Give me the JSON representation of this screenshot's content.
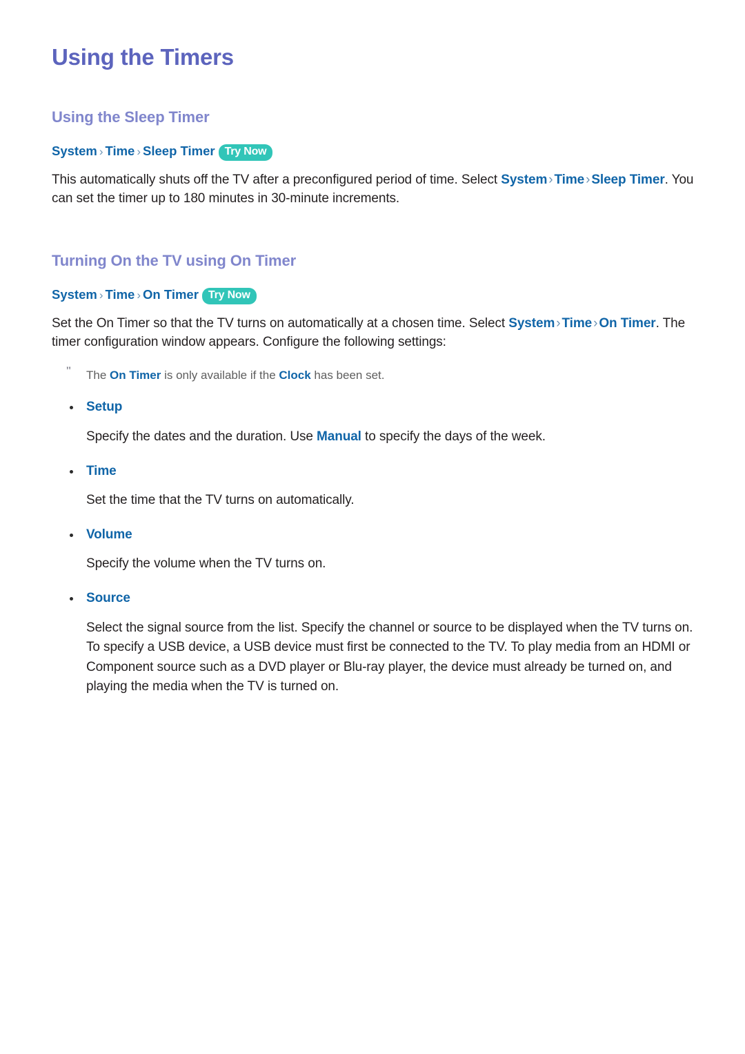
{
  "document": {
    "title": "Using the Timers"
  },
  "sections": [
    {
      "heading": "Using the Sleep Timer",
      "breadcrumb": {
        "crumbs": [
          "System",
          "Time",
          "Sleep Timer"
        ],
        "separator": "›",
        "badge": "Try Now"
      },
      "paragraph": {
        "part1": "This automatically shuts off the TV after a preconfigured period of time. Select ",
        "menu1": "System",
        "sep1": "›",
        "menu2": "Time",
        "sep2": "›",
        "menu3": "Sleep Timer",
        "part2": ". You can set the timer up to 180 minutes in 30-minute increments."
      }
    },
    {
      "heading": "Turning On the TV using On Timer",
      "breadcrumb": {
        "crumbs": [
          "System",
          "Time",
          "On Timer"
        ],
        "separator": "›",
        "badge": "Try Now"
      },
      "paragraph": {
        "part1": "Set the On Timer so that the TV turns on automatically at a chosen time. Select ",
        "menu1": "System",
        "sep1": "›",
        "menu2": "Time",
        "sep2": "›",
        "menu3": "On Timer",
        "part2": ". The timer configuration window appears. Configure the following settings:"
      },
      "note": {
        "icon": "quote-mark",
        "glyph": "\"",
        "part1": "The ",
        "menu1": "On Timer",
        "part2": " is only available if the ",
        "menu2": "Clock",
        "part3": " has been set."
      },
      "bullets": [
        {
          "label": "Setup",
          "desc_part1": "Specify the dates and the duration. Use ",
          "desc_menu": "Manual",
          "desc_part2": " to specify the days of the week."
        },
        {
          "label": "Time",
          "desc_part1": "Set the time that the TV turns on automatically.",
          "desc_menu": "",
          "desc_part2": ""
        },
        {
          "label": "Volume",
          "desc_part1": "Specify the volume when the TV turns on.",
          "desc_menu": "",
          "desc_part2": ""
        },
        {
          "label": "Source",
          "desc_part1": "Select the signal source from the list. Specify the channel or source to be displayed when the TV turns on. To specify a USB device, a USB device must first be connected to the TV. To play media from an HDMI or Component source such as a DVD player or Blu-ray player, the device must already be turned on, and playing the media when the TV is turned on.",
          "desc_menu": "",
          "desc_part2": ""
        }
      ]
    }
  ],
  "colors": {
    "page_title": "#5c64bd",
    "section_heading": "#8086cc",
    "menu_link": "#1065a8",
    "badge_bg": "#31c5b8",
    "badge_text": "#ffffff",
    "body_text": "#231f20",
    "note_text": "#5e5e5e",
    "background": "#ffffff"
  }
}
